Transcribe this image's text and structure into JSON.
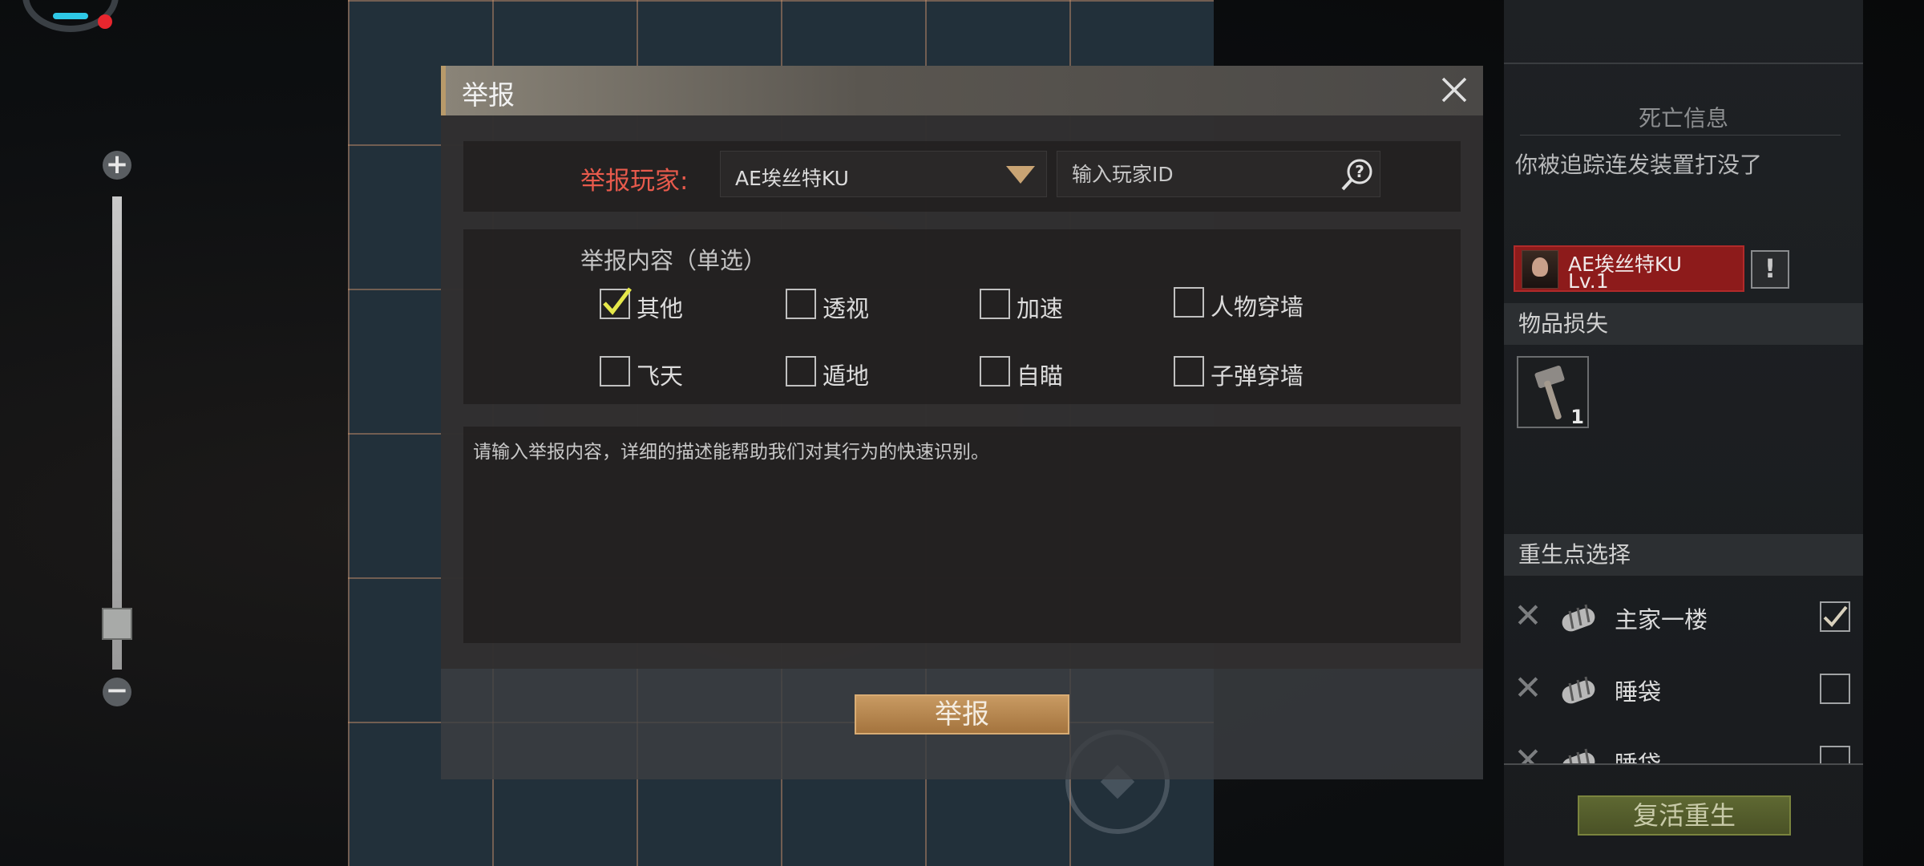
{
  "hud": {
    "zoom_in": "+",
    "zoom_out": "−",
    "zoom_level": 0.05
  },
  "report_dialog": {
    "title": "举报",
    "player_label": "举报玩家:",
    "selected_player": "AE埃丝特KU",
    "player_id_placeholder": "输入玩家ID",
    "content_title": "举报内容（单选）",
    "options": [
      {
        "label": "其他",
        "checked": true
      },
      {
        "label": "透视",
        "checked": false
      },
      {
        "label": "加速",
        "checked": false
      },
      {
        "label": "人物穿墙",
        "checked": false
      },
      {
        "label": "飞天",
        "checked": false
      },
      {
        "label": "遁地",
        "checked": false
      },
      {
        "label": "自瞄",
        "checked": false
      },
      {
        "label": "子弹穿墙",
        "checked": false
      }
    ],
    "description_placeholder": "请输入举报内容，详细的描述能帮助我们对其行为的快速识别。",
    "submit_label": "举报",
    "accent_color": "#e85a4c"
  },
  "death_panel": {
    "title": "死亡信息",
    "message": "你被追踪连发装置打没了",
    "killer": {
      "name": "AE埃丝特KU",
      "level": "Lv.1",
      "report_icon": "!"
    },
    "items_header": "物品损失",
    "lost_items": [
      {
        "icon": "hammer-icon",
        "count": "1"
      }
    ],
    "respawn_header": "重生点选择",
    "respawn_points": [
      {
        "label": "主家一楼",
        "selected": true
      },
      {
        "label": "睡袋",
        "selected": false
      },
      {
        "label": "睡袋",
        "selected": false
      }
    ],
    "revive_label": "复活重生"
  }
}
